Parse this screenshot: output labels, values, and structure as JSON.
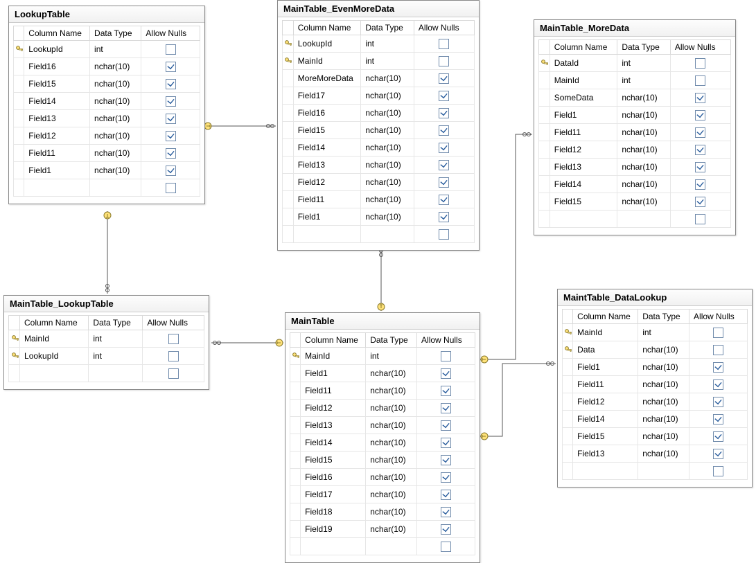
{
  "headers": {
    "col": "Column Name",
    "type": "Data Type",
    "nulls": "Allow Nulls"
  },
  "tables": {
    "lookup": {
      "title": "LookupTable",
      "rows": [
        {
          "key": true,
          "name": "LookupId",
          "type": "int",
          "null": false
        },
        {
          "key": false,
          "name": "Field16",
          "type": "nchar(10)",
          "null": true
        },
        {
          "key": false,
          "name": "Field15",
          "type": "nchar(10)",
          "null": true
        },
        {
          "key": false,
          "name": "Field14",
          "type": "nchar(10)",
          "null": true
        },
        {
          "key": false,
          "name": "Field13",
          "type": "nchar(10)",
          "null": true
        },
        {
          "key": false,
          "name": "Field12",
          "type": "nchar(10)",
          "null": true
        },
        {
          "key": false,
          "name": "Field11",
          "type": "nchar(10)",
          "null": true
        },
        {
          "key": false,
          "name": "Field1",
          "type": "nchar(10)",
          "null": true
        },
        {
          "key": false,
          "name": "",
          "type": "",
          "null": false
        }
      ]
    },
    "evenmore": {
      "title": "MainTable_EvenMoreData",
      "rows": [
        {
          "key": true,
          "name": "LookupId",
          "type": "int",
          "null": false
        },
        {
          "key": true,
          "name": "MainId",
          "type": "int",
          "null": false
        },
        {
          "key": false,
          "name": "MoreMoreData",
          "type": "nchar(10)",
          "null": true
        },
        {
          "key": false,
          "name": "Field17",
          "type": "nchar(10)",
          "null": true
        },
        {
          "key": false,
          "name": "Field16",
          "type": "nchar(10)",
          "null": true
        },
        {
          "key": false,
          "name": "Field15",
          "type": "nchar(10)",
          "null": true
        },
        {
          "key": false,
          "name": "Field14",
          "type": "nchar(10)",
          "null": true
        },
        {
          "key": false,
          "name": "Field13",
          "type": "nchar(10)",
          "null": true
        },
        {
          "key": false,
          "name": "Field12",
          "type": "nchar(10)",
          "null": true
        },
        {
          "key": false,
          "name": "Field11",
          "type": "nchar(10)",
          "null": true
        },
        {
          "key": false,
          "name": "Field1",
          "type": "nchar(10)",
          "null": true
        },
        {
          "key": false,
          "name": "",
          "type": "",
          "null": false
        }
      ]
    },
    "moredata": {
      "title": "MainTable_MoreData",
      "rows": [
        {
          "key": true,
          "name": "DataId",
          "type": "int",
          "null": false
        },
        {
          "key": false,
          "name": "MainId",
          "type": "int",
          "null": false
        },
        {
          "key": false,
          "name": "SomeData",
          "type": "nchar(10)",
          "null": true
        },
        {
          "key": false,
          "name": "Field1",
          "type": "nchar(10)",
          "null": true
        },
        {
          "key": false,
          "name": "Field11",
          "type": "nchar(10)",
          "null": true
        },
        {
          "key": false,
          "name": "Field12",
          "type": "nchar(10)",
          "null": true
        },
        {
          "key": false,
          "name": "Field13",
          "type": "nchar(10)",
          "null": true
        },
        {
          "key": false,
          "name": "Field14",
          "type": "nchar(10)",
          "null": true
        },
        {
          "key": false,
          "name": "Field15",
          "type": "nchar(10)",
          "null": true
        },
        {
          "key": false,
          "name": "",
          "type": "",
          "null": false
        }
      ]
    },
    "lookupjoin": {
      "title": "MainTable_LookupTable",
      "rows": [
        {
          "key": true,
          "name": "MainId",
          "type": "int",
          "null": false
        },
        {
          "key": true,
          "name": "LookupId",
          "type": "int",
          "null": false
        },
        {
          "key": false,
          "name": "",
          "type": "",
          "null": false
        }
      ]
    },
    "main": {
      "title": "MainTable",
      "rows": [
        {
          "key": true,
          "name": "MainId",
          "type": "int",
          "null": false
        },
        {
          "key": false,
          "name": "Field1",
          "type": "nchar(10)",
          "null": true
        },
        {
          "key": false,
          "name": "Field11",
          "type": "nchar(10)",
          "null": true
        },
        {
          "key": false,
          "name": "Field12",
          "type": "nchar(10)",
          "null": true
        },
        {
          "key": false,
          "name": "Field13",
          "type": "nchar(10)",
          "null": true
        },
        {
          "key": false,
          "name": "Field14",
          "type": "nchar(10)",
          "null": true
        },
        {
          "key": false,
          "name": "Field15",
          "type": "nchar(10)",
          "null": true
        },
        {
          "key": false,
          "name": "Field16",
          "type": "nchar(10)",
          "null": true
        },
        {
          "key": false,
          "name": "Field17",
          "type": "nchar(10)",
          "null": true
        },
        {
          "key": false,
          "name": "Field18",
          "type": "nchar(10)",
          "null": true
        },
        {
          "key": false,
          "name": "Field19",
          "type": "nchar(10)",
          "null": true
        },
        {
          "key": false,
          "name": "",
          "type": "",
          "null": false
        }
      ]
    },
    "datalookup": {
      "title": "MaintTable_DataLookup",
      "rows": [
        {
          "key": true,
          "name": "MainId",
          "type": "int",
          "null": false
        },
        {
          "key": true,
          "name": "Data",
          "type": "nchar(10)",
          "null": false
        },
        {
          "key": false,
          "name": "Field1",
          "type": "nchar(10)",
          "null": true
        },
        {
          "key": false,
          "name": "Field11",
          "type": "nchar(10)",
          "null": true
        },
        {
          "key": false,
          "name": "Field12",
          "type": "nchar(10)",
          "null": true
        },
        {
          "key": false,
          "name": "Field14",
          "type": "nchar(10)",
          "null": true
        },
        {
          "key": false,
          "name": "Field15",
          "type": "nchar(10)",
          "null": true
        },
        {
          "key": false,
          "name": "Field13",
          "type": "nchar(10)",
          "null": true
        },
        {
          "key": false,
          "name": "",
          "type": "",
          "null": false
        }
      ]
    }
  }
}
